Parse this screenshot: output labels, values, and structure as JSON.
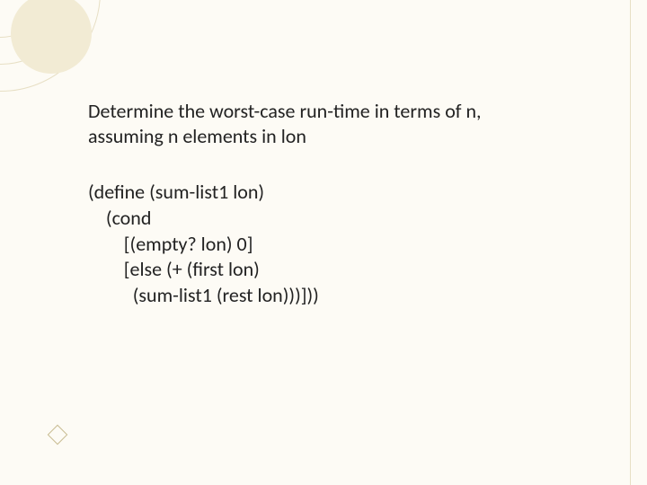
{
  "prompt": {
    "line1": "Determine the worst-case run-time in terms of n,",
    "line2": "assuming n elements in lon"
  },
  "code": {
    "line1": "(define (sum-list1 lon)",
    "line2": "    (cond",
    "line3": "        [(empty? lon) 0]",
    "line4": "        [else (+ (first lon)",
    "line5": "          (sum-list1 (rest lon)))]))"
  }
}
